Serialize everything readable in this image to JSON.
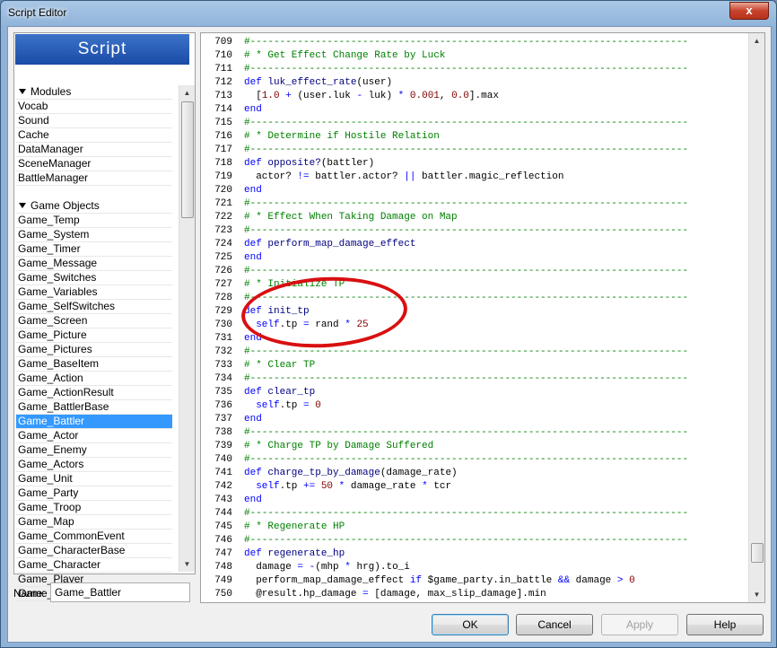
{
  "window": {
    "title": "Script Editor",
    "close_label": "x"
  },
  "script_list": {
    "header": "Script",
    "items": [
      {
        "label": "Modules",
        "kind": "section"
      },
      {
        "label": "Vocab"
      },
      {
        "label": "Sound"
      },
      {
        "label": "Cache"
      },
      {
        "label": "DataManager"
      },
      {
        "label": "SceneManager"
      },
      {
        "label": "BattleManager"
      },
      {
        "label": "",
        "kind": "blank"
      },
      {
        "label": "Game Objects",
        "kind": "section"
      },
      {
        "label": "Game_Temp"
      },
      {
        "label": "Game_System"
      },
      {
        "label": "Game_Timer"
      },
      {
        "label": "Game_Message"
      },
      {
        "label": "Game_Switches"
      },
      {
        "label": "Game_Variables"
      },
      {
        "label": "Game_SelfSwitches"
      },
      {
        "label": "Game_Screen"
      },
      {
        "label": "Game_Picture"
      },
      {
        "label": "Game_Pictures"
      },
      {
        "label": "Game_BaseItem"
      },
      {
        "label": "Game_Action"
      },
      {
        "label": "Game_ActionResult"
      },
      {
        "label": "Game_BattlerBase"
      },
      {
        "label": "Game_Battler",
        "selected": true
      },
      {
        "label": "Game_Actor"
      },
      {
        "label": "Game_Enemy"
      },
      {
        "label": "Game_Actors"
      },
      {
        "label": "Game_Unit"
      },
      {
        "label": "Game_Party"
      },
      {
        "label": "Game_Troop"
      },
      {
        "label": "Game_Map"
      },
      {
        "label": "Game_CommonEvent"
      },
      {
        "label": "Game_CharacterBase"
      },
      {
        "label": "Game_Character"
      },
      {
        "label": "Game_Player"
      },
      {
        "label": "Game_Follower"
      }
    ],
    "scroll_position": 0.0
  },
  "name_field": {
    "label": "Name:",
    "value": "Game_Battler"
  },
  "code": {
    "lines": [
      {
        "n": "709",
        "t": [
          [
            "c-comment",
            "#--------------------------------------------------------------------------"
          ]
        ]
      },
      {
        "n": "710",
        "t": [
          [
            "c-comment",
            "# * Get Effect Change Rate by Luck"
          ]
        ]
      },
      {
        "n": "711",
        "t": [
          [
            "c-comment",
            "#--------------------------------------------------------------------------"
          ]
        ]
      },
      {
        "n": "712",
        "t": [
          [
            "c-kw",
            "def "
          ],
          [
            "c-txt",
            "luk_effect_rate"
          ],
          [
            "c-plain",
            "(user)"
          ]
        ]
      },
      {
        "n": "713",
        "t": [
          [
            "c-plain",
            "  ["
          ],
          [
            "c-num",
            "1.0"
          ],
          [
            "c-op",
            " + "
          ],
          [
            "c-plain",
            "(user.luk "
          ],
          [
            "c-op",
            "-"
          ],
          [
            "c-plain",
            " luk) "
          ],
          [
            "c-op",
            "*"
          ],
          [
            "c-plain",
            " "
          ],
          [
            "c-num",
            "0.001"
          ],
          [
            "c-plain",
            ", "
          ],
          [
            "c-num",
            "0.0"
          ],
          [
            "c-plain",
            "].max"
          ]
        ]
      },
      {
        "n": "714",
        "t": [
          [
            "c-kw",
            "end"
          ]
        ]
      },
      {
        "n": "715",
        "t": [
          [
            "c-comment",
            "#--------------------------------------------------------------------------"
          ]
        ]
      },
      {
        "n": "716",
        "t": [
          [
            "c-comment",
            "# * Determine if Hostile Relation"
          ]
        ]
      },
      {
        "n": "717",
        "t": [
          [
            "c-comment",
            "#--------------------------------------------------------------------------"
          ]
        ]
      },
      {
        "n": "718",
        "t": [
          [
            "c-kw",
            "def "
          ],
          [
            "c-txt",
            "opposite?"
          ],
          [
            "c-plain",
            "(battler)"
          ]
        ]
      },
      {
        "n": "719",
        "t": [
          [
            "c-plain",
            "  actor? "
          ],
          [
            "c-op",
            "!="
          ],
          [
            "c-plain",
            " battler.actor? "
          ],
          [
            "c-op",
            "||"
          ],
          [
            "c-plain",
            " battler.magic_reflection"
          ]
        ]
      },
      {
        "n": "720",
        "t": [
          [
            "c-kw",
            "end"
          ]
        ]
      },
      {
        "n": "721",
        "t": [
          [
            "c-comment",
            "#--------------------------------------------------------------------------"
          ]
        ]
      },
      {
        "n": "722",
        "t": [
          [
            "c-comment",
            "# * Effect When Taking Damage on Map"
          ]
        ]
      },
      {
        "n": "723",
        "t": [
          [
            "c-comment",
            "#--------------------------------------------------------------------------"
          ]
        ]
      },
      {
        "n": "724",
        "t": [
          [
            "c-kw",
            "def "
          ],
          [
            "c-txt",
            "perform_map_damage_effect"
          ]
        ]
      },
      {
        "n": "725",
        "t": [
          [
            "c-kw",
            "end"
          ]
        ]
      },
      {
        "n": "726",
        "t": [
          [
            "c-comment",
            "#--------------------------------------------------------------------------"
          ]
        ]
      },
      {
        "n": "727",
        "t": [
          [
            "c-comment",
            "# * Initialize TP"
          ]
        ]
      },
      {
        "n": "728",
        "t": [
          [
            "c-comment",
            "#--------------------------------------------------------------------------"
          ]
        ]
      },
      {
        "n": "729",
        "t": [
          [
            "c-kw",
            "def "
          ],
          [
            "c-txt",
            "init_tp"
          ]
        ]
      },
      {
        "n": "730",
        "t": [
          [
            "c-plain",
            "  "
          ],
          [
            "c-kw",
            "self"
          ],
          [
            "c-plain",
            ".tp "
          ],
          [
            "c-op",
            "="
          ],
          [
            "c-plain",
            " rand "
          ],
          [
            "c-op",
            "*"
          ],
          [
            "c-plain",
            " "
          ],
          [
            "c-num",
            "25"
          ]
        ]
      },
      {
        "n": "731",
        "t": [
          [
            "c-kw",
            "end"
          ]
        ]
      },
      {
        "n": "732",
        "t": [
          [
            "c-comment",
            "#--------------------------------------------------------------------------"
          ]
        ]
      },
      {
        "n": "733",
        "t": [
          [
            "c-comment",
            "# * Clear TP"
          ]
        ]
      },
      {
        "n": "734",
        "t": [
          [
            "c-comment",
            "#--------------------------------------------------------------------------"
          ]
        ]
      },
      {
        "n": "735",
        "t": [
          [
            "c-kw",
            "def "
          ],
          [
            "c-txt",
            "clear_tp"
          ]
        ]
      },
      {
        "n": "736",
        "t": [
          [
            "c-plain",
            "  "
          ],
          [
            "c-kw",
            "self"
          ],
          [
            "c-plain",
            ".tp "
          ],
          [
            "c-op",
            "="
          ],
          [
            "c-plain",
            " "
          ],
          [
            "c-num",
            "0"
          ]
        ]
      },
      {
        "n": "737",
        "t": [
          [
            "c-kw",
            "end"
          ]
        ]
      },
      {
        "n": "738",
        "t": [
          [
            "c-comment",
            "#--------------------------------------------------------------------------"
          ]
        ]
      },
      {
        "n": "739",
        "t": [
          [
            "c-comment",
            "# * Charge TP by Damage Suffered"
          ]
        ]
      },
      {
        "n": "740",
        "t": [
          [
            "c-comment",
            "#--------------------------------------------------------------------------"
          ]
        ]
      },
      {
        "n": "741",
        "t": [
          [
            "c-kw",
            "def "
          ],
          [
            "c-txt",
            "charge_tp_by_damage"
          ],
          [
            "c-plain",
            "(damage_rate)"
          ]
        ]
      },
      {
        "n": "742",
        "t": [
          [
            "c-plain",
            "  "
          ],
          [
            "c-kw",
            "self"
          ],
          [
            "c-plain",
            ".tp "
          ],
          [
            "c-op",
            "+="
          ],
          [
            "c-plain",
            " "
          ],
          [
            "c-num",
            "50"
          ],
          [
            "c-plain",
            " "
          ],
          [
            "c-op",
            "*"
          ],
          [
            "c-plain",
            " damage_rate "
          ],
          [
            "c-op",
            "*"
          ],
          [
            "c-plain",
            " tcr"
          ]
        ]
      },
      {
        "n": "743",
        "t": [
          [
            "c-kw",
            "end"
          ]
        ]
      },
      {
        "n": "744",
        "t": [
          [
            "c-comment",
            "#--------------------------------------------------------------------------"
          ]
        ]
      },
      {
        "n": "745",
        "t": [
          [
            "c-comment",
            "# * Regenerate HP"
          ]
        ]
      },
      {
        "n": "746",
        "t": [
          [
            "c-comment",
            "#--------------------------------------------------------------------------"
          ]
        ]
      },
      {
        "n": "747",
        "t": [
          [
            "c-kw",
            "def "
          ],
          [
            "c-txt",
            "regenerate_hp"
          ]
        ]
      },
      {
        "n": "748",
        "t": [
          [
            "c-plain",
            "  damage "
          ],
          [
            "c-op",
            "="
          ],
          [
            "c-plain",
            " "
          ],
          [
            "c-op",
            "-"
          ],
          [
            "c-plain",
            "(mhp "
          ],
          [
            "c-op",
            "*"
          ],
          [
            "c-plain",
            " hrg).to_i"
          ]
        ]
      },
      {
        "n": "749",
        "t": [
          [
            "c-plain",
            "  perform_map_damage_effect "
          ],
          [
            "c-kw",
            "if"
          ],
          [
            "c-plain",
            " $game_party.in_battle "
          ],
          [
            "c-op",
            "&&"
          ],
          [
            "c-plain",
            " damage "
          ],
          [
            "c-op",
            ">"
          ],
          [
            "c-plain",
            " "
          ],
          [
            "c-num",
            "0"
          ]
        ]
      },
      {
        "n": "750",
        "t": [
          [
            "c-plain",
            "  @result.hp_damage "
          ],
          [
            "c-op",
            "="
          ],
          [
            "c-plain",
            " [damage, max_slip_damage].min"
          ]
        ]
      }
    ],
    "scroll_position": 0.95
  },
  "buttons": {
    "ok": "OK",
    "cancel": "Cancel",
    "apply": "Apply",
    "help": "Help"
  }
}
